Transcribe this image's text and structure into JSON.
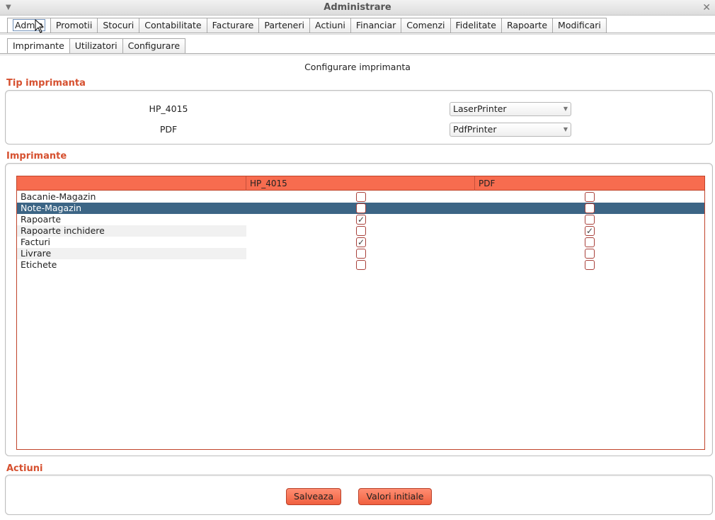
{
  "window": {
    "title": "Administrare"
  },
  "main_tabs": [
    "Admin",
    "Promotii",
    "Stocuri",
    "Contabilitate",
    "Facturare",
    "Parteneri",
    "Actiuni",
    "Financiar",
    "Comenzi",
    "Fidelitate",
    "Rapoarte",
    "Modificari"
  ],
  "sub_tabs": [
    "Imprimante",
    "Utilizatori",
    "Configurare"
  ],
  "form_title": "Configurare imprimanta",
  "tip_section": {
    "label": "Tip imprimanta",
    "printers": [
      {
        "name": "HP_4015",
        "type": "LaserPrinter"
      },
      {
        "name": "PDF",
        "type": "PdfPrinter"
      }
    ]
  },
  "imprimante_section": {
    "label": "Imprimante",
    "columns": [
      "",
      "HP_4015",
      "PDF"
    ],
    "rows": [
      {
        "name": "Bacanie-Magazin",
        "hp": false,
        "pdf": false
      },
      {
        "name": "Note-Magazin",
        "hp": false,
        "pdf": false
      },
      {
        "name": "Rapoarte",
        "hp": true,
        "pdf": false
      },
      {
        "name": "Rapoarte inchidere",
        "hp": false,
        "pdf": true
      },
      {
        "name": "Facturi",
        "hp": true,
        "pdf": false
      },
      {
        "name": "Livrare",
        "hp": false,
        "pdf": false
      },
      {
        "name": "Etichete",
        "hp": false,
        "pdf": false
      }
    ]
  },
  "actiuni_section": {
    "label": "Actiuni",
    "save_label": "Salveaza",
    "reset_label": "Valori initiale"
  },
  "colors": {
    "accent": "#f76c4f",
    "section_label": "#d6502f",
    "selection": "#3c6585"
  }
}
